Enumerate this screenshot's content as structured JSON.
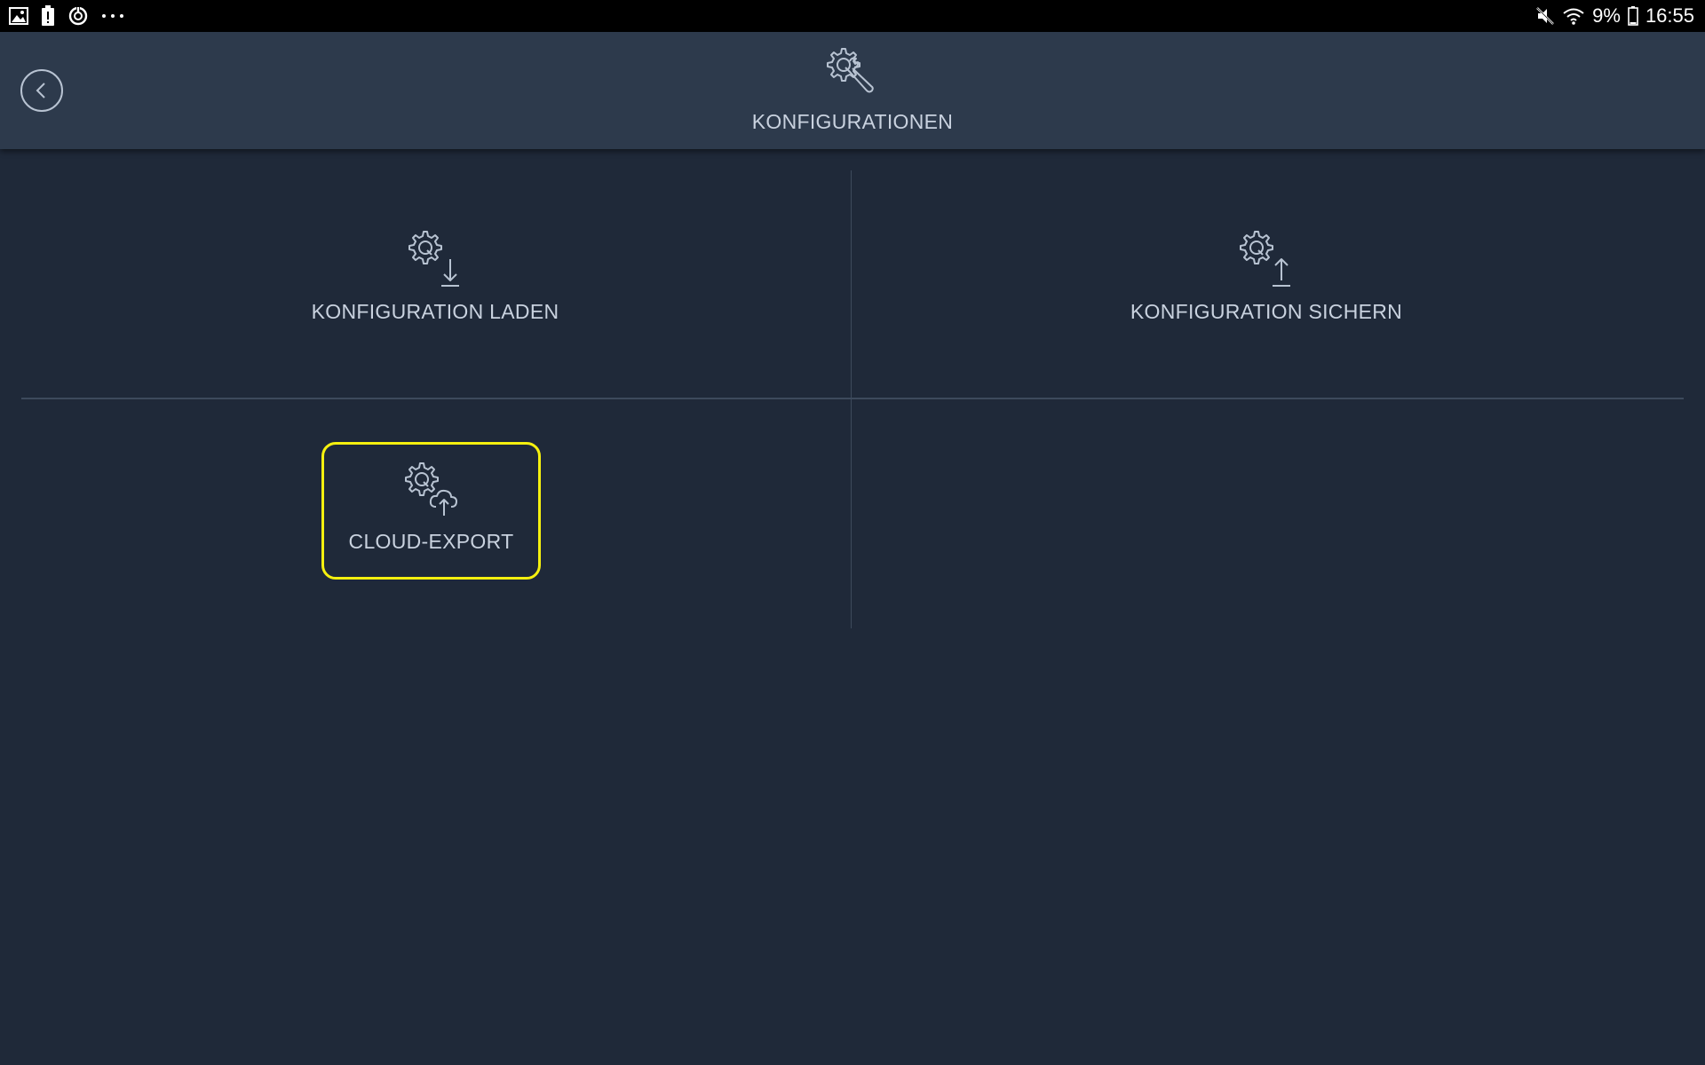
{
  "status_bar": {
    "left_icons": [
      "gallery-icon",
      "battery-alert-icon",
      "sync-icon",
      "more-dots-icon"
    ],
    "right_icons": [
      "mute-icon",
      "wifi-icon",
      "battery-icon"
    ],
    "battery_percent": "9%",
    "time": "16:55"
  },
  "header": {
    "title": "KONFIGURATIONEN",
    "icon": "gear-wrench-icon",
    "back_icon": "back-chevron-icon"
  },
  "tiles": [
    {
      "label": "KONFIGURATION LADEN",
      "icon": "gear-download-icon"
    },
    {
      "label": "KONFIGURATION SICHERN",
      "icon": "gear-upload-icon"
    },
    {
      "label": "CLOUD-EXPORT",
      "icon": "gear-cloud-upload-icon",
      "highlight_color": "#f5f00f"
    }
  ],
  "colors": {
    "background": "#1f2939",
    "header_background": "#2d3a4c",
    "text": "#c9d2df",
    "divider": "#3d4a5c",
    "highlight": "#f5f00f"
  }
}
